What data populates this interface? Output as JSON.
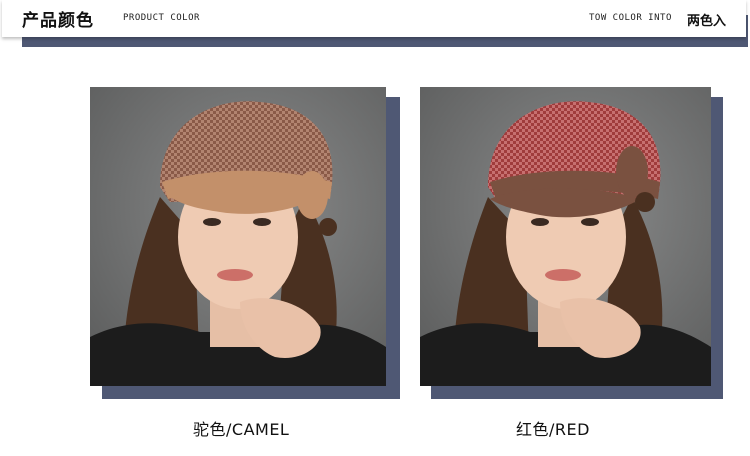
{
  "header": {
    "title_cn": "产品颜色",
    "title_en": "PRODUCT COLOR",
    "right_en": "TOW COLOR INTO",
    "right_cn": "两色入"
  },
  "products": [
    {
      "caption": "驼色/CAMEL",
      "hat_color": "#c3906a",
      "hat_tweed": "#8a5a48",
      "hat_tweed_light": "#b28470"
    },
    {
      "caption": "红色/RED",
      "hat_color": "#7a5140",
      "hat_tweed": "#a03c3c",
      "hat_tweed_light": "#c77070"
    }
  ],
  "colors": {
    "accent_navy": "#4f5874",
    "photo_background": "#6f7070"
  }
}
